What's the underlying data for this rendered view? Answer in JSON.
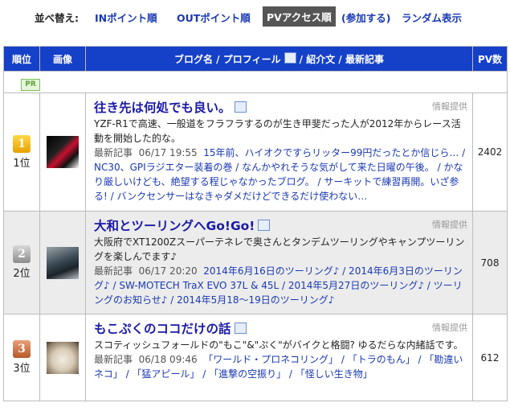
{
  "sort": {
    "label": "並べ替え:",
    "options": [
      "INポイント順",
      "OUTポイント順",
      "PVアクセス順",
      "(参加する)",
      "ランダム表示"
    ]
  },
  "headers": {
    "rank": "順位",
    "image": "画像",
    "blog": "ブログ名 / プロフィール",
    "blog_tail": " / 紹介文 / 最新記事",
    "pv": "PV数"
  },
  "pr_badge": "PR",
  "rows": [
    {
      "rank_num": "1",
      "rank_label": "1位",
      "title": "往き先は何処でも良い。",
      "info": "情報提供",
      "description": "YZF-R1で高速、一般道をフラフラするのが生き甲斐だった人が2012年からレース活動を開始した的な。",
      "recent_label": "最新記事",
      "recent_date": "06/17 19:55",
      "recent_posts": "15年前、ハイオクですらリッター99円だったとか信じら… / NC30、GPIラジエター装着の巻 / なんかやれそうな気がして来た日曜の午後。 / かなり厳しいけども、絶望する程じゃなかったブログ。 / サーキットで練習再開。いざ参る! / バンクセンサーはなきゃダメだけどできるだけ使わない…",
      "pv": "2402"
    },
    {
      "rank_num": "2",
      "rank_label": "2位",
      "title": "大和とツーリングへGo!Go!",
      "info": "情報提供",
      "description": "大阪府でXT1200Zスーパーテネレで奥さんとタンデムツーリングやキャンプツーリングを楽しんでます♪",
      "recent_label": "最新記事",
      "recent_date": "06/17 20:20",
      "recent_posts": "2014年6月16日のツーリング♪ / 2014年6月3日のツーリング♪ / SW-MOTECH TraX EVO 37L & 45L / 2014年5月27日のツーリング♪ / ツーリングのお知らせ♪ / 2014年5月18〜19日のツーリング♪",
      "pv": "708"
    },
    {
      "rank_num": "3",
      "rank_label": "3位",
      "title": "もこぷくのココだけの話",
      "info": "情報提供",
      "description": "スコティッシュフォールドの\"もこ\"&\"ぷく\"がバイクと格闘? ゆるだらな内緒話です。",
      "recent_label": "最新記事",
      "recent_date": "06/18 09:46",
      "recent_posts": "「ワールド・プロネコリング」 / 「トラのもん」 / 「勘違いネコ」 / 「猛アピール」 / 「進撃の空振り」 / 「怪しい生き物」",
      "pv": "612"
    }
  ]
}
